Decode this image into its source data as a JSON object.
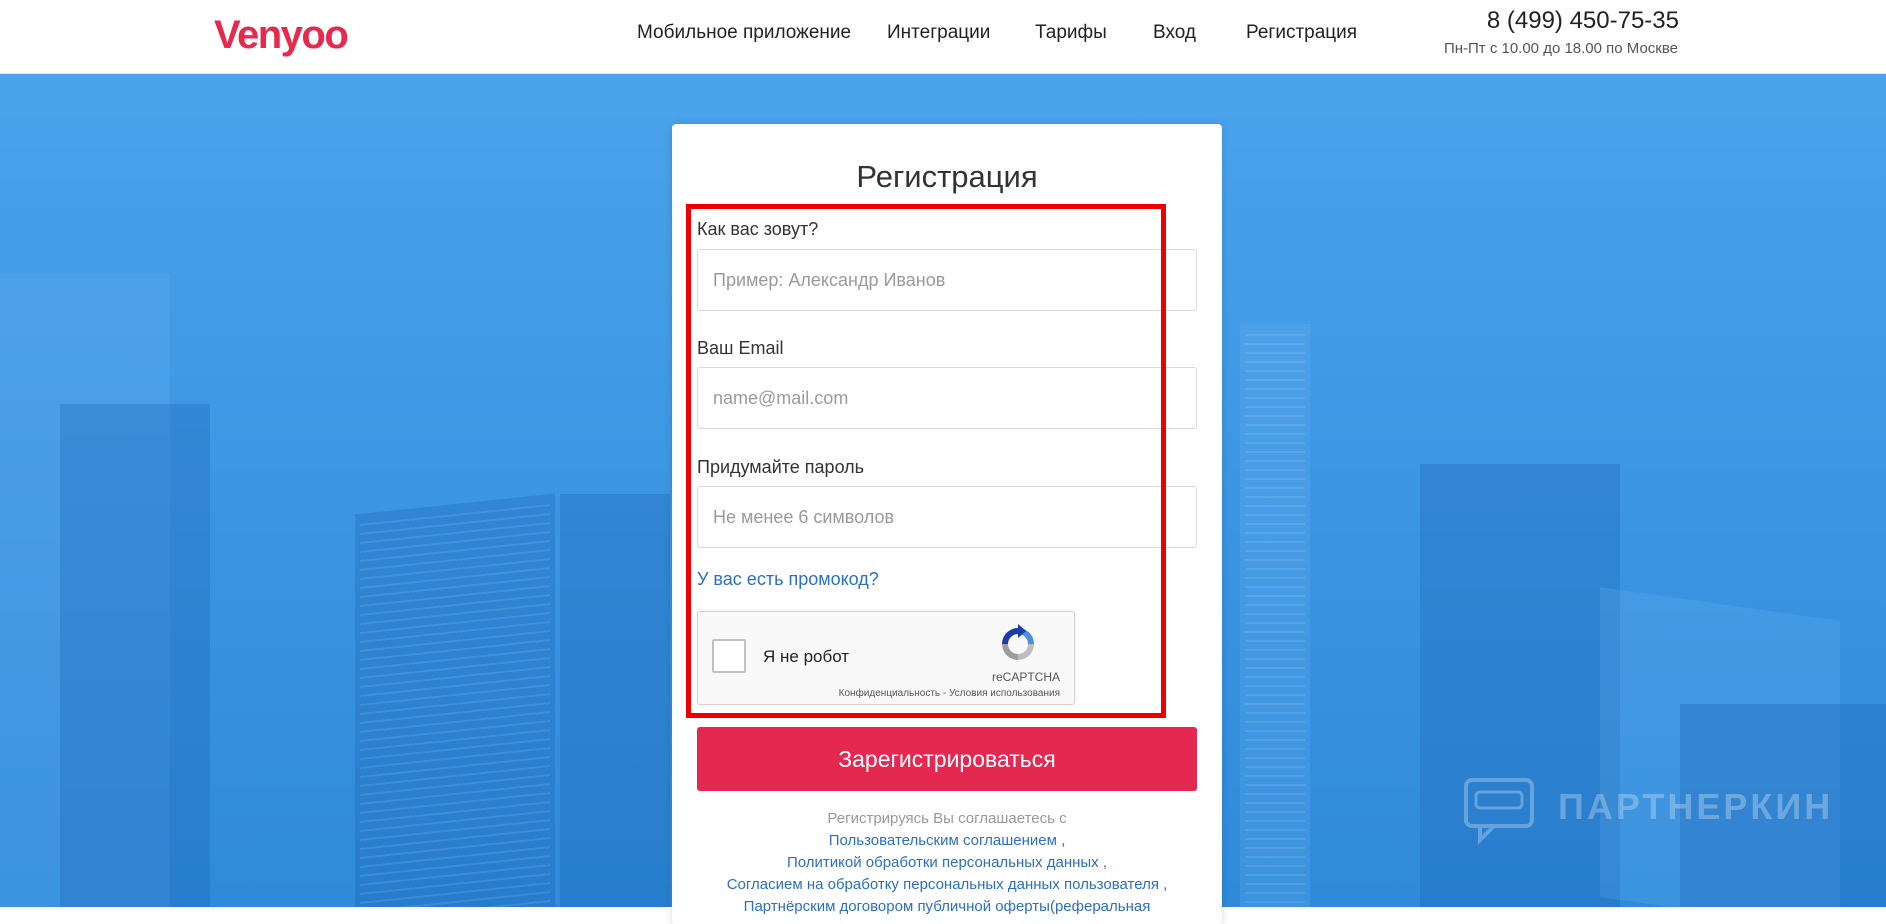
{
  "header": {
    "logo": "Venyoo",
    "nav": [
      {
        "label": "Мобильное приложение"
      },
      {
        "label": "Интеграции"
      },
      {
        "label": "Тарифы"
      },
      {
        "label": "Вход"
      },
      {
        "label": "Регистрация"
      }
    ],
    "phone": "8 (499) 450-75-35",
    "hours": "Пн-Пт с 10.00 до 18.00 по Москве"
  },
  "form": {
    "title": "Регистрация",
    "name": {
      "label": "Как вас зовут?",
      "placeholder": "Пример: Александр Иванов",
      "value": ""
    },
    "email": {
      "label": "Ваш Email",
      "placeholder": "name@mail.com",
      "value": ""
    },
    "password": {
      "label": "Придумайте пароль",
      "placeholder": "Не менее 6 символов",
      "value": ""
    },
    "promo_link": "У вас есть промокод?",
    "recaptcha": {
      "label": "Я не робот",
      "brand": "reCAPTCHA",
      "terms": "Конфиденциальность - Условия использования",
      "checked": false
    },
    "submit_label": "Зарегистрироваться",
    "agreement": {
      "intro": "Регистрируясь Вы соглашаетесь с",
      "links": [
        {
          "text": "Пользовательским соглашением",
          "sep": " ,"
        },
        {
          "text": "Политикой обработки персональных данных",
          "sep": " ,"
        },
        {
          "text": "Согласием на обработку персональных данных пользователя",
          "sep": " ,"
        },
        {
          "text": "Партнёрским договором публичной оферты(реферальная",
          "sep": ""
        }
      ]
    }
  },
  "watermark": "ПАРТНЕРКИН",
  "colors": {
    "brand": "#e8294e",
    "button": "#e4284f",
    "link": "#2a6fc9",
    "background": "#3e97e4",
    "highlight": "#ee0000"
  },
  "icons": {
    "recaptcha": "recaptcha-logo-icon",
    "watermark": "chat-bubble-icon"
  }
}
